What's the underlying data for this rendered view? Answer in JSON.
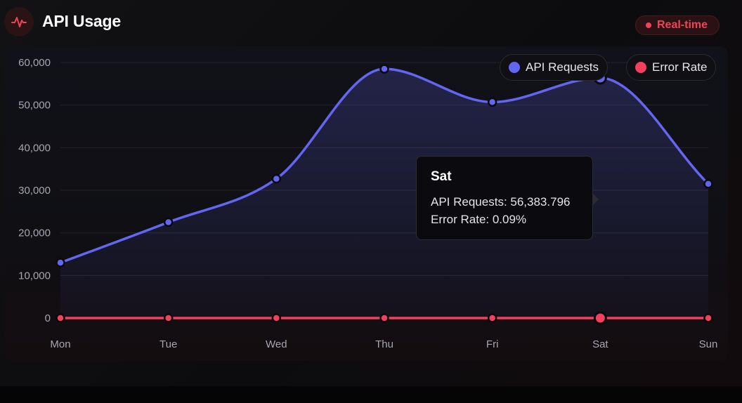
{
  "header": {
    "title": "API Usage",
    "icon": "activity-pulse-icon",
    "badge_label": "Real-time"
  },
  "colors": {
    "requests": "#6366f1",
    "errors": "#f43f5e",
    "badge": "#ef4456"
  },
  "legend": [
    {
      "label": "API Requests",
      "color": "#6366f1"
    },
    {
      "label": "Error Rate",
      "color": "#f43f5e"
    }
  ],
  "tooltip": {
    "title": "Sat",
    "requests_line": "API Requests: 56,383.796",
    "error_line": "Error Rate: 0.09%"
  },
  "chart_data": {
    "type": "line",
    "categories": [
      "Mon",
      "Tue",
      "Wed",
      "Thu",
      "Fri",
      "Sat",
      "Sun"
    ],
    "series": [
      {
        "name": "API Requests",
        "values": [
          13000,
          22500,
          32700,
          58500,
          50700,
          56383.796,
          31500
        ],
        "fill": true
      },
      {
        "name": "Error Rate",
        "values": [
          0,
          0,
          0,
          0,
          0,
          0.09,
          0
        ]
      }
    ],
    "ylim": [
      0,
      60000
    ],
    "yticks": [
      "0",
      "10,000",
      "20,000",
      "30,000",
      "40,000",
      "50,000",
      "60,000"
    ],
    "ytick_values": [
      0,
      10000,
      20000,
      30000,
      40000,
      50000,
      60000
    ],
    "grid": true,
    "legend_position": "top-right",
    "highlighted_category": "Sat"
  }
}
